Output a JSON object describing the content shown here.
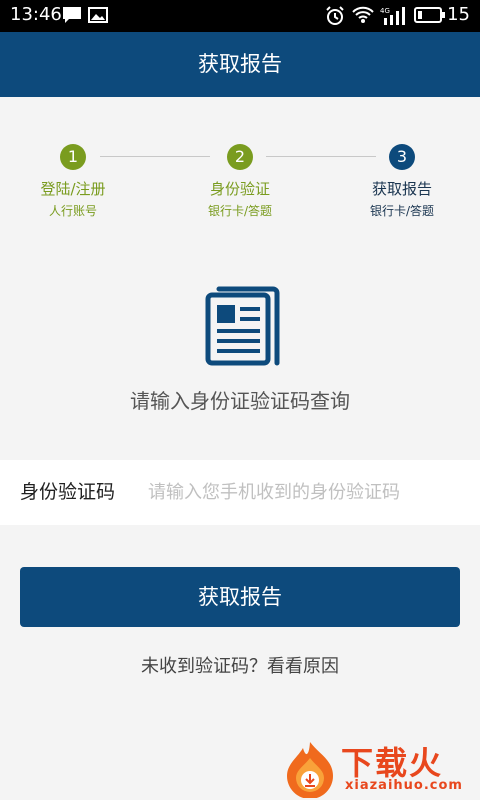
{
  "status_bar": {
    "time": "13:46",
    "battery": "15"
  },
  "header": {
    "title": "获取报告"
  },
  "steps": [
    {
      "num": "1",
      "title": "登陆/注册",
      "subtitle": "人行账号"
    },
    {
      "num": "2",
      "title": "身份验证",
      "subtitle": "银行卡/答题"
    },
    {
      "num": "3",
      "title": "获取报告",
      "subtitle": "银行卡/答题"
    }
  ],
  "prompt": "请输入身份证验证码查询",
  "form": {
    "code_label": "身份验证码",
    "code_value": "",
    "code_placeholder": "请输入您手机收到的身份验证码"
  },
  "submit_label": "获取报告",
  "help_link": "未收到验证码？看看原因",
  "watermark": {
    "brand": "下载火",
    "domain": "xiazaihuo.com"
  },
  "colors": {
    "primary": "#0d4a7c",
    "done": "#7a9c1f",
    "background": "#f4f4f4"
  }
}
